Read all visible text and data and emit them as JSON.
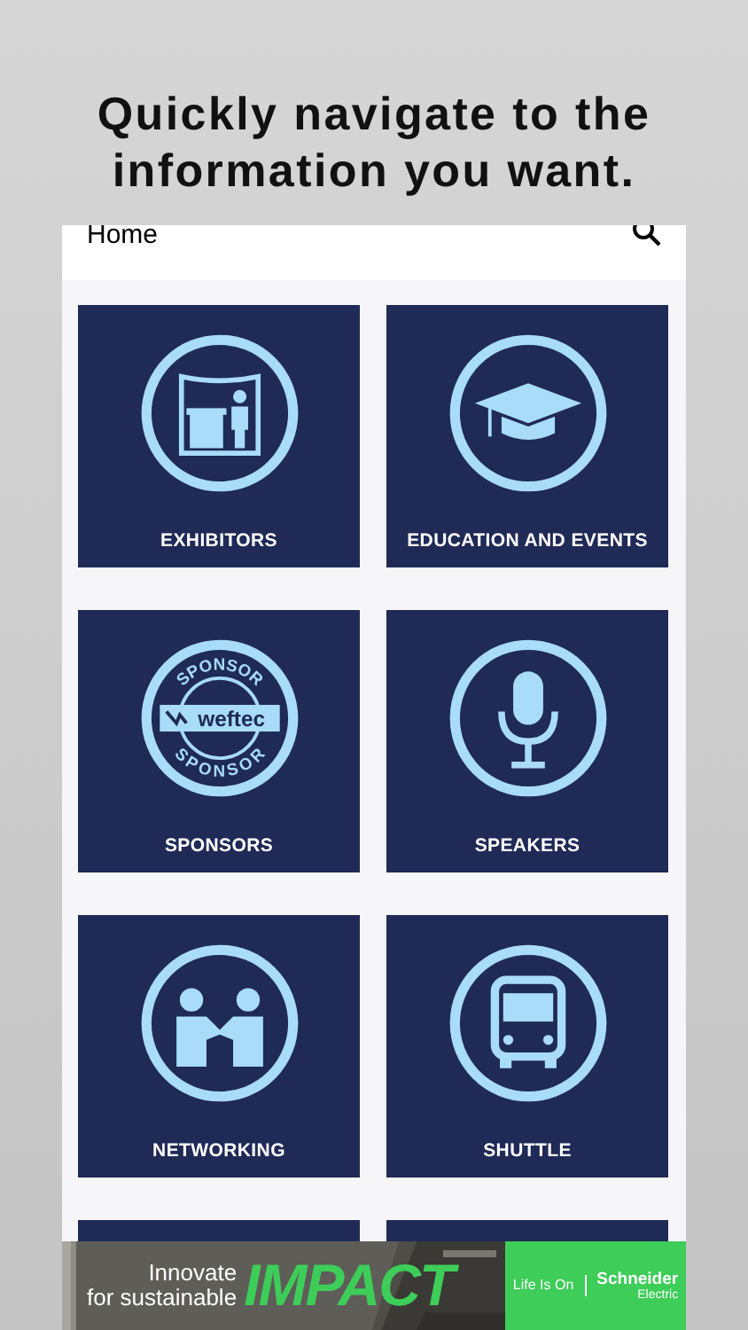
{
  "headline": "Quickly navigate to the information you want.",
  "header": {
    "title": "Home"
  },
  "tiles": [
    {
      "kind": "exhibitor",
      "label": "EXHIBITORS"
    },
    {
      "kind": "education",
      "label": "EDUCATION AND EVENTS"
    },
    {
      "kind": "sponsor",
      "label": "SPONSORS",
      "logo": {
        "top": "SPONSOR",
        "middle": "weftec",
        "bottom": "SPONSOR"
      }
    },
    {
      "kind": "microphone",
      "label": "SPEAKERS"
    },
    {
      "kind": "networking",
      "label": "NETWORKING"
    },
    {
      "kind": "bus",
      "label": "SHUTTLE"
    },
    {
      "kind": "hidden"
    },
    {
      "kind": "hidden"
    }
  ],
  "ad": {
    "line1": "Innovate",
    "line2": "for sustainable",
    "headline": "IMPACT",
    "tagline": "Life Is On",
    "brand": "Schneider",
    "brand_sub": "Electric"
  }
}
